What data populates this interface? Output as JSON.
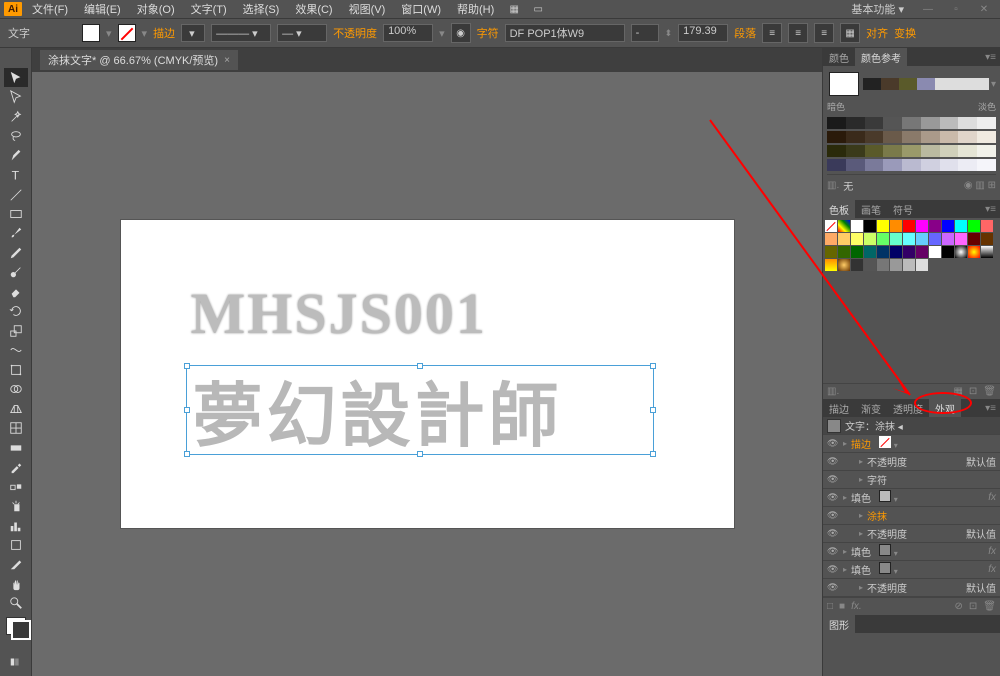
{
  "app": {
    "logo": "Ai",
    "workspace": "基本功能"
  },
  "menu": {
    "file": "文件(F)",
    "edit": "编辑(E)",
    "object": "对象(O)",
    "type": "文字(T)",
    "select": "选择(S)",
    "effect": "效果(C)",
    "view": "视图(V)",
    "window": "窗口(W)",
    "help": "帮助(H)"
  },
  "controlbar": {
    "type_label": "文字",
    "stroke": "描边",
    "opacity_label": "不透明度",
    "opacity_value": "100%",
    "font_label": "字符",
    "font_name": "DF POP1体W9",
    "font_size": "179.39",
    "paragraph": "段落",
    "align": "对齐",
    "transform": "变换"
  },
  "doc_tab": {
    "name": "涂抹文字* @ 66.67% (CMYK/预览)",
    "close": "×"
  },
  "canvas": {
    "text1": "MHSJS001",
    "text2": "夢幻設計師"
  },
  "panels": {
    "color_tabs": [
      "颜色",
      "颜色参考"
    ],
    "shade_labels": {
      "dark": "暗色",
      "light": "淡色"
    },
    "none_label": "无",
    "swatch_tabs": [
      "色板",
      "画笔",
      "符号"
    ],
    "appearance_tabs": [
      "描边",
      "渐变",
      "透明度",
      "外观"
    ],
    "graph_label": "图形",
    "appearance": {
      "title_prefix": "文字：",
      "title": "涂抹",
      "rows": [
        {
          "label": "描边",
          "type": "stroke",
          "color": "none"
        },
        {
          "label": "不透明度",
          "value": "默认值",
          "indent": true
        },
        {
          "label": "字符",
          "type": "normal",
          "indent": true
        },
        {
          "label": "填色",
          "type": "fill",
          "color": "#bbb"
        },
        {
          "label": "涂抹",
          "type": "effect",
          "indent": true
        },
        {
          "label": "不透明度",
          "value": "默认值",
          "indent": true
        },
        {
          "label": "填色",
          "type": "fill",
          "color": "#888"
        },
        {
          "label": "填色",
          "type": "fill",
          "color": "#888"
        },
        {
          "label": "不透明度",
          "value": "默认值",
          "indent": true
        }
      ]
    }
  }
}
